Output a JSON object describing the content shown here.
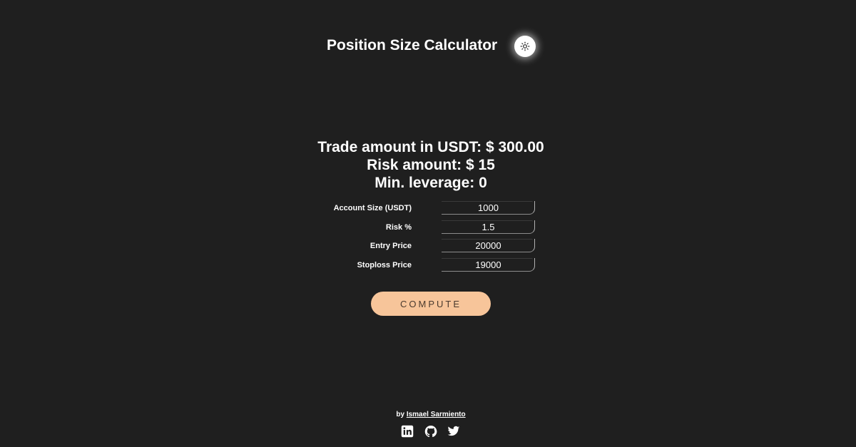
{
  "header": {
    "title": "Position Size Calculator",
    "theme_toggle_icon": "sun-icon"
  },
  "results": {
    "trade_amount": "Trade amount in USDT: $ 300.00",
    "risk_amount": "Risk amount: $ 15",
    "min_leverage": "Min. leverage: 0"
  },
  "form": {
    "fields": [
      {
        "label": "Account Size (USDT)",
        "value": "1000"
      },
      {
        "label": "Risk %",
        "value": "1.5"
      },
      {
        "label": "Entry Price",
        "value": "20000"
      },
      {
        "label": "Stoploss Price",
        "value": "19000"
      }
    ],
    "compute_label": "COMPUTE"
  },
  "footer": {
    "by": "by",
    "author": "Ismael Sarmiento",
    "socials": [
      "linkedin-icon",
      "github-icon",
      "twitter-icon"
    ]
  },
  "colors": {
    "background": "#1f1f1f",
    "text": "#ffffff",
    "button": "#f7c59a"
  }
}
